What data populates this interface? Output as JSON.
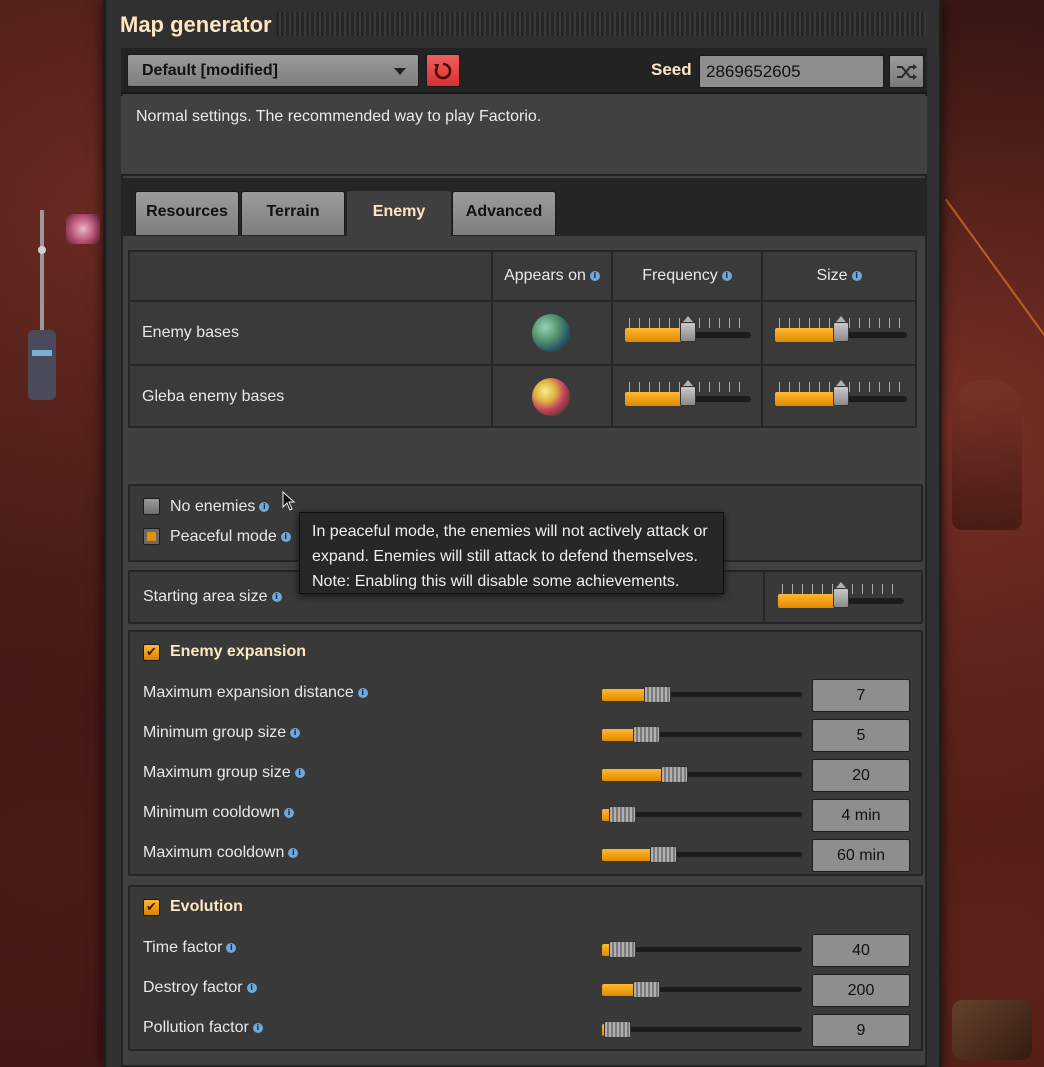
{
  "window": {
    "title": "Map generator"
  },
  "toolbar": {
    "preset_value": "Default [modified]",
    "reset_icon": "reset-icon",
    "seed_label": "Seed",
    "seed_value": "2869652605",
    "shuffle_icon": "shuffle-icon"
  },
  "description": "Normal settings. The recommended way to play Factorio.",
  "tabs": [
    {
      "label": "Resources",
      "active": false
    },
    {
      "label": "Terrain",
      "active": false
    },
    {
      "label": "Enemy",
      "active": true
    },
    {
      "label": "Advanced",
      "active": false
    }
  ],
  "bases_table": {
    "headers": {
      "appears_on": "Appears on",
      "frequency": "Frequency",
      "size": "Size"
    },
    "rows": [
      {
        "label": "Enemy bases",
        "planet": "nauvis",
        "frequency": 0.5,
        "size": 0.5
      },
      {
        "label": "Gleba enemy bases",
        "planet": "gleba",
        "frequency": 0.5,
        "size": 0.5
      }
    ]
  },
  "options": {
    "no_enemies": {
      "label": "No enemies",
      "checked": false
    },
    "peaceful_mode": {
      "label": "Peaceful mode",
      "checked": false,
      "hovered": true
    }
  },
  "starting_area": {
    "label": "Starting area size",
    "value": 0.5
  },
  "tooltip": {
    "lines": [
      "In peaceful mode, the enemies will not actively attack or",
      "expand. Enemies will still attack to defend themselves.",
      "Note: Enabling this will disable some achievements."
    ]
  },
  "enemy_expansion": {
    "title": "Enemy expansion",
    "enabled": true,
    "rows": [
      {
        "label": "Maximum expansion distance",
        "value": "7",
        "fraction": 0.24
      },
      {
        "label": "Minimum group size",
        "value": "5",
        "fraction": 0.18
      },
      {
        "label": "Maximum group size",
        "value": "20",
        "fraction": 0.34
      },
      {
        "label": "Minimum cooldown",
        "value": "4 min",
        "fraction": 0.04
      },
      {
        "label": "Maximum cooldown",
        "value": "60 min",
        "fraction": 0.28
      }
    ]
  },
  "evolution": {
    "title": "Evolution",
    "enabled": true,
    "rows": [
      {
        "label": "Time factor",
        "value": "40",
        "fraction": 0.04
      },
      {
        "label": "Destroy factor",
        "value": "200",
        "fraction": 0.18
      },
      {
        "label": "Pollution factor",
        "value": "9",
        "fraction": 0.01
      }
    ]
  },
  "colors": {
    "accent": "#f0a020",
    "title": "#ffe6c0",
    "info": "#6fa8dc",
    "reset": "#e84848"
  }
}
